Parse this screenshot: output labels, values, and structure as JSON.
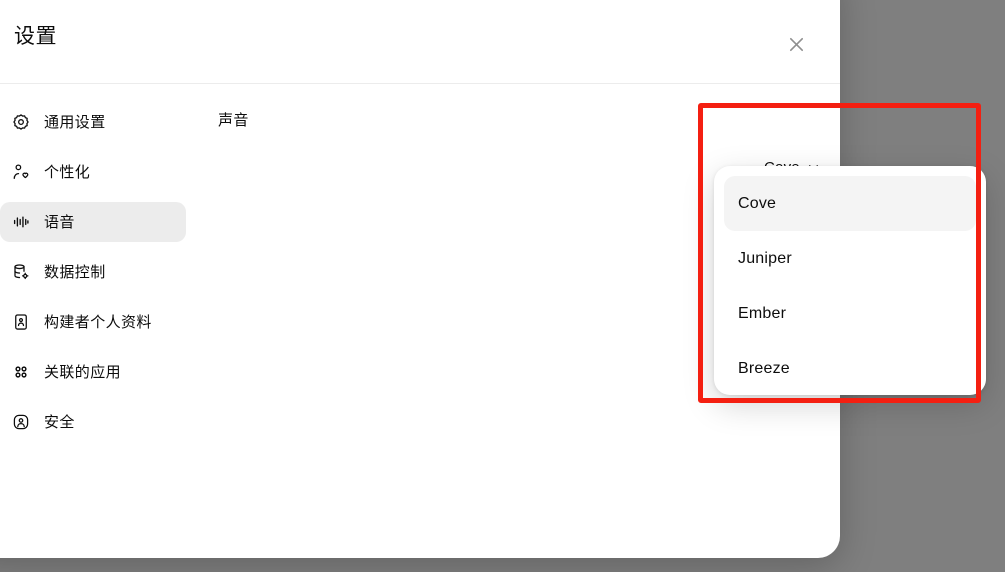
{
  "window": {
    "backdrop_color": "#7f7f7f"
  },
  "dialog": {
    "title": "设置",
    "close_label": "关闭",
    "close_icon": "close-icon"
  },
  "sidebar": {
    "items": [
      {
        "label": "通用设置",
        "icon": "gear-icon",
        "active": false
      },
      {
        "label": "个性化",
        "icon": "person-heart-icon",
        "active": false
      },
      {
        "label": "语音",
        "icon": "audio-waveform-icon",
        "active": true
      },
      {
        "label": "数据控制",
        "icon": "database-gear-icon",
        "active": false
      },
      {
        "label": "构建者个人资料",
        "icon": "id-card-icon",
        "active": false
      },
      {
        "label": "关联的应用",
        "icon": "grid-apps-icon",
        "active": false
      },
      {
        "label": "安全",
        "icon": "shield-user-icon",
        "active": false
      }
    ]
  },
  "main": {
    "settings": [
      {
        "label": "声音"
      }
    ]
  },
  "voice_select": {
    "selected": "Cove",
    "chevron_icon": "chevron-down-icon",
    "open": true,
    "options": [
      {
        "label": "Cove",
        "selected": true
      },
      {
        "label": "Juniper",
        "selected": false
      },
      {
        "label": "Ember",
        "selected": false
      },
      {
        "label": "Breeze",
        "selected": false
      }
    ]
  },
  "annotation": {
    "highlight_color": "#f41f11"
  }
}
